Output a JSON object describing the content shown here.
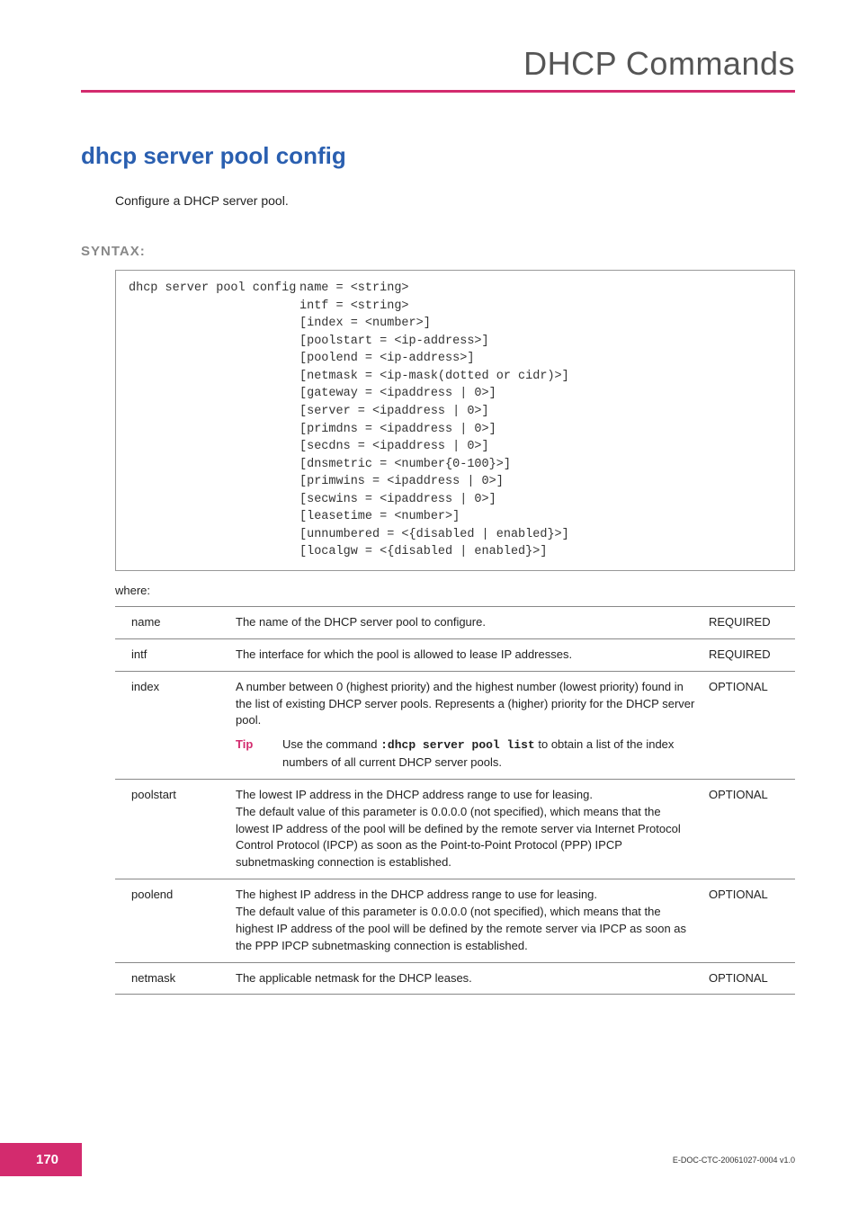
{
  "header": {
    "chapter": "DHCP Commands"
  },
  "title": "dhcp server pool config",
  "description": "Configure a DHCP server pool.",
  "syntax_label": "SYNTAX:",
  "syntax": {
    "command": "dhcp server pool config",
    "args": "name = <string>\nintf = <string>\n[index = <number>]\n[poolstart = <ip-address>]\n[poolend = <ip-address>]\n[netmask = <ip-mask(dotted or cidr)>]\n[gateway = <ipaddress | 0>]\n[server = <ipaddress | 0>]\n[primdns = <ipaddress | 0>]\n[secdns = <ipaddress | 0>]\n[dnsmetric = <number{0-100}>]\n[primwins = <ipaddress | 0>]\n[secwins = <ipaddress | 0>]\n[leasetime = <number>]\n[unnumbered = <{disabled | enabled}>]\n[localgw = <{disabled | enabled}>]"
  },
  "where_label": "where:",
  "params": [
    {
      "name": "name",
      "desc": "The name of the DHCP server pool to configure.",
      "req": "REQUIRED"
    },
    {
      "name": "intf",
      "desc": "The interface for which the pool is allowed to lease IP addresses.",
      "req": "REQUIRED"
    },
    {
      "name": "index",
      "desc": "A number between 0 (highest priority) and the highest number (lowest priority) found in the list of existing DHCP server pools. Represents a (higher) priority for the DHCP server pool.",
      "req": "OPTIONAL",
      "tip": {
        "label": "Tip",
        "pre": "Use the command ",
        "cmd": ":dhcp server pool list",
        "post": " to obtain a list of the index numbers of all current DHCP server pools."
      }
    },
    {
      "name": "poolstart",
      "desc": "The lowest IP address in the DHCP address range to use for leasing.\nThe default value of this parameter is 0.0.0.0 (not specified), which means that the lowest IP address of the pool will be defined by the remote server via Internet Protocol Control Protocol (IPCP) as soon as the Point-to-Point Protocol (PPP) IPCP subnetmasking connection is established.",
      "req": "OPTIONAL"
    },
    {
      "name": "poolend",
      "desc": "The highest IP address in the DHCP address range to use for leasing.\nThe default value of this parameter is 0.0.0.0 (not specified), which means that the highest IP address of the pool will be defined by the remote server via IPCP as soon as the PPP IPCP subnetmasking connection is established.",
      "req": "OPTIONAL"
    },
    {
      "name": "netmask",
      "desc": "The applicable netmask for the DHCP leases.",
      "req": "OPTIONAL"
    }
  ],
  "footer": {
    "page": "170",
    "docid": "E-DOC-CTC-20061027-0004 v1.0"
  }
}
